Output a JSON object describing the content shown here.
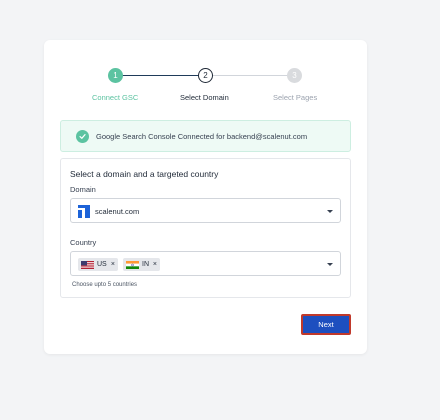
{
  "stepper": {
    "steps": [
      {
        "number": "1",
        "label": "Connect GSC",
        "state": "completed"
      },
      {
        "number": "2",
        "label": "Select Domain",
        "state": "active"
      },
      {
        "number": "3",
        "label": "Select Pages",
        "state": "pending"
      }
    ]
  },
  "alert": {
    "text": "Google Search Console Connected for backend@scalenut.com",
    "icon": "check-circle-icon"
  },
  "form": {
    "title": "Select a domain and a targeted country",
    "domain": {
      "label": "Domain",
      "value": "scalenut.com"
    },
    "country": {
      "label": "Country",
      "chips": [
        {
          "code": "US",
          "remove": "×"
        },
        {
          "code": "IN",
          "remove": "×"
        }
      ],
      "hint": "Choose upto 5 countries"
    }
  },
  "actions": {
    "next_label": "Next"
  },
  "colors": {
    "accent_green": "#5cc3a1",
    "primary_blue": "#1d4fbf",
    "focus_outline": "#c0392b"
  }
}
